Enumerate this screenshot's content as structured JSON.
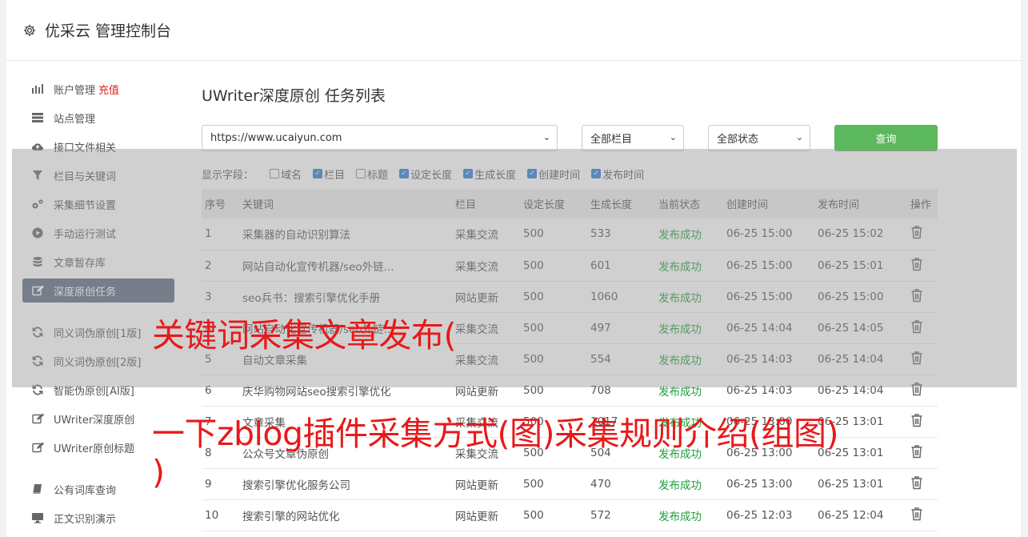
{
  "app": {
    "title": "优采云 管理控制台",
    "icon": "gear-icon"
  },
  "sidebar": {
    "items": [
      {
        "icon": "bar-chart-icon",
        "label": "账户管理",
        "extra": "充值"
      },
      {
        "icon": "server-icon",
        "label": "站点管理"
      },
      {
        "icon": "cloud-upload-icon",
        "label": "接口文件相关"
      },
      {
        "icon": "filter-icon",
        "label": "栏目与关键词"
      },
      {
        "icon": "gears-icon",
        "label": "采集细节设置"
      },
      {
        "icon": "play-circle-icon",
        "label": "手动运行测试"
      },
      {
        "icon": "database-icon",
        "label": "文章暂存库"
      },
      {
        "icon": "edit-icon",
        "label": "深度原创任务",
        "active": true
      },
      {
        "icon": "refresh-icon",
        "label": "同义词伪原创[1版]"
      },
      {
        "icon": "refresh-icon",
        "label": "同义词伪原创[2版]"
      },
      {
        "icon": "refresh-icon",
        "label": "智能伪原创[AI版]"
      },
      {
        "icon": "edit-icon",
        "label": "UWriter深度原创"
      },
      {
        "icon": "edit-icon",
        "label": "UWriter原创标题"
      },
      {
        "icon": "book-icon",
        "label": "公有词库查询"
      },
      {
        "icon": "monitor-icon",
        "label": "正文识别演示"
      }
    ]
  },
  "main": {
    "title": "UWriter深度原创 任务列表",
    "site_select": "https://www.ucaiyun.com",
    "column_select": "全部栏目",
    "status_select": "全部状态",
    "query_button": "查询",
    "fields_label": "显示字段：",
    "fields": [
      {
        "label": "域名",
        "checked": false
      },
      {
        "label": "栏目",
        "checked": true
      },
      {
        "label": "标题",
        "checked": false
      },
      {
        "label": "设定长度",
        "checked": true
      },
      {
        "label": "生成长度",
        "checked": true
      },
      {
        "label": "创建时间",
        "checked": true
      },
      {
        "label": "发布时间",
        "checked": true
      }
    ],
    "columns": [
      "序号",
      "关键词",
      "栏目",
      "设定长度",
      "生成长度",
      "当前状态",
      "创建时间",
      "发布时间",
      "操作"
    ],
    "rows": [
      [
        "1",
        "采集器的自动识别算法",
        "采集交流",
        "500",
        "533",
        "发布成功",
        "06-25 15:00",
        "06-25 15:02"
      ],
      [
        "2",
        "网站自动化宣传机器/seo外链...",
        "采集交流",
        "500",
        "601",
        "发布成功",
        "06-25 15:00",
        "06-25 15:01"
      ],
      [
        "3",
        "seo兵书：搜索引擎优化手册",
        "网站更新",
        "500",
        "1060",
        "发布成功",
        "06-25 15:00",
        "06-25 15:00"
      ],
      [
        "4",
        "网站自动化宣传机器/seo外链...",
        "采集交流",
        "500",
        "497",
        "发布成功",
        "06-25 14:04",
        "06-25 14:05"
      ],
      [
        "5",
        "自动文章采集",
        "采集交流",
        "500",
        "554",
        "发布成功",
        "06-25 14:03",
        "06-25 14:04"
      ],
      [
        "6",
        "庆华购物网站seo搜索引擎优化",
        "网站更新",
        "500",
        "708",
        "发布成功",
        "06-25 14:03",
        "06-25 14:04"
      ],
      [
        "7",
        "文章采集",
        "采集交流",
        "500",
        "1017",
        "发布成功",
        "06-25 13:00",
        "06-25 13:01"
      ],
      [
        "8",
        "公众号文章伪原创",
        "采集交流",
        "500",
        "504",
        "发布成功",
        "06-25 13:00",
        "06-25 13:01"
      ],
      [
        "9",
        "搜索引擎优化服务公司",
        "网站更新",
        "500",
        "470",
        "发布成功",
        "06-25 13:00",
        "06-25 13:01"
      ],
      [
        "10",
        "搜索引擎的网站优化",
        "网站更新",
        "500",
        "572",
        "发布成功",
        "06-25 12:03",
        "06-25 12:04"
      ]
    ],
    "delete_icon": "trash-icon"
  },
  "overlay": {
    "line1": "关键词采集文章发布(",
    "line2": "一下zblog插件采集方式(图)采集规则介绍(组图)",
    "line3": ")"
  },
  "colors": {
    "success": "#1e9e3a",
    "query_button": "#5cb85c",
    "active_nav": "#5a6a80",
    "overlay_text": "#e8191a"
  }
}
